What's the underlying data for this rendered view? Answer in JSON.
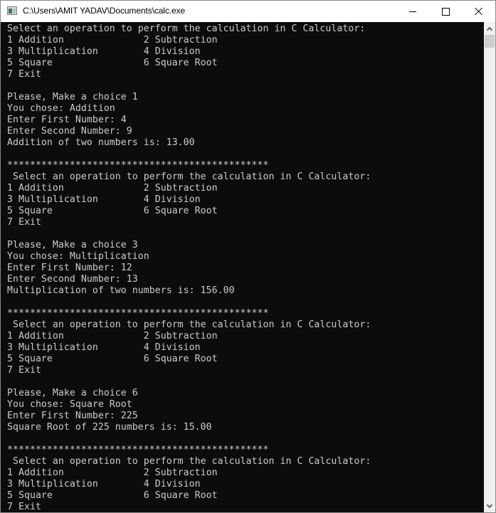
{
  "window": {
    "title": "C:\\Users\\AMIT YADAV\\Documents\\calc.exe",
    "icon": "console-app-icon",
    "controls": {
      "minimize": "minimize-icon",
      "maximize": "maximize-icon",
      "close": "close-icon"
    }
  },
  "console": {
    "background": "#0c0c0c",
    "foreground": "#cccccc",
    "lines": [
      "Select an operation to perform the calculation in C Calculator:",
      "1 Addition              2 Subtraction",
      "3 Multiplication        4 Division",
      "5 Square                6 Square Root",
      "7 Exit",
      "",
      "Please, Make a choice 1",
      "You chose: Addition",
      "Enter First Number: 4",
      "Enter Second Number: 9",
      "Addition of two numbers is: 13.00",
      "",
      "**********************************************",
      " Select an operation to perform the calculation in C Calculator:",
      "1 Addition              2 Subtraction",
      "3 Multiplication        4 Division",
      "5 Square                6 Square Root",
      "7 Exit",
      "",
      "Please, Make a choice 3",
      "You chose: Multiplication",
      "Enter First Number: 12",
      "Enter Second Number: 13",
      "Multiplication of two numbers is: 156.00",
      "",
      "**********************************************",
      " Select an operation to perform the calculation in C Calculator:",
      "1 Addition              2 Subtraction",
      "3 Multiplication        4 Division",
      "5 Square                6 Square Root",
      "7 Exit",
      "",
      "Please, Make a choice 6",
      "You chose: Square Root",
      "Enter First Number: 225",
      "Square Root of 225 numbers is: 15.00",
      "",
      "**********************************************",
      " Select an operation to perform the calculation in C Calculator:",
      "1 Addition              2 Subtraction",
      "3 Multiplication        4 Division",
      "5 Square                6 Square Root",
      "7 Exit"
    ]
  },
  "scrollbar": {
    "up": "chevron-up-icon",
    "down": "chevron-down-icon"
  }
}
